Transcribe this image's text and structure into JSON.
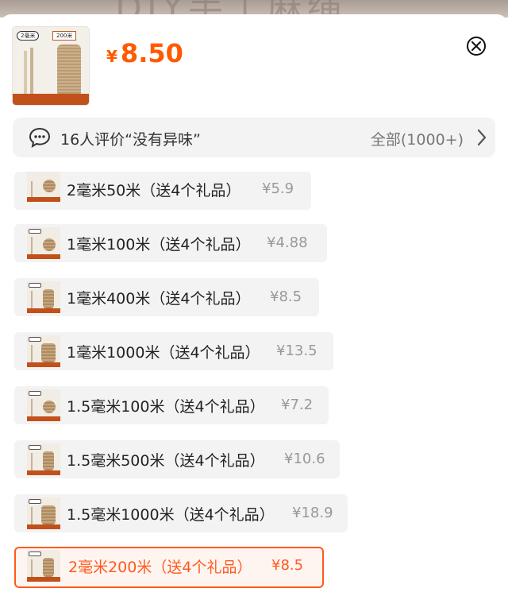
{
  "header": {
    "product_tag": "2毫米",
    "product_length": "200米",
    "currency": "¥",
    "price": "8.50"
  },
  "review": {
    "summary": "16人评价“没有异味”",
    "all_label": "全部(1000+)"
  },
  "options": [
    {
      "label": "2毫米50米（送4个礼品）",
      "price": "¥5.9",
      "selected": false
    },
    {
      "label": "1毫米100米（送4个礼品）",
      "price": "¥4.88",
      "selected": false
    },
    {
      "label": "1毫米400米（送4个礼品）",
      "price": "¥8.5",
      "selected": false
    },
    {
      "label": "1毫米1000米（送4个礼品）",
      "price": "¥13.5",
      "selected": false
    },
    {
      "label": "1.5毫米100米（送4个礼品）",
      "price": "¥7.2",
      "selected": false
    },
    {
      "label": "1.5毫米500米（送4个礼品）",
      "price": "¥10.6",
      "selected": false
    },
    {
      "label": "1.5毫米1000米（送4个礼品）",
      "price": "¥18.9",
      "selected": false
    },
    {
      "label": "2毫米200米（送4个礼品）",
      "price": "¥8.5",
      "selected": true
    }
  ],
  "colors": {
    "accent": "#ff5a1f",
    "price": "#ff5a00"
  },
  "icons": {
    "close": "close-icon",
    "chat": "chat-bubble-icon",
    "chevron": "chevron-right-icon"
  }
}
